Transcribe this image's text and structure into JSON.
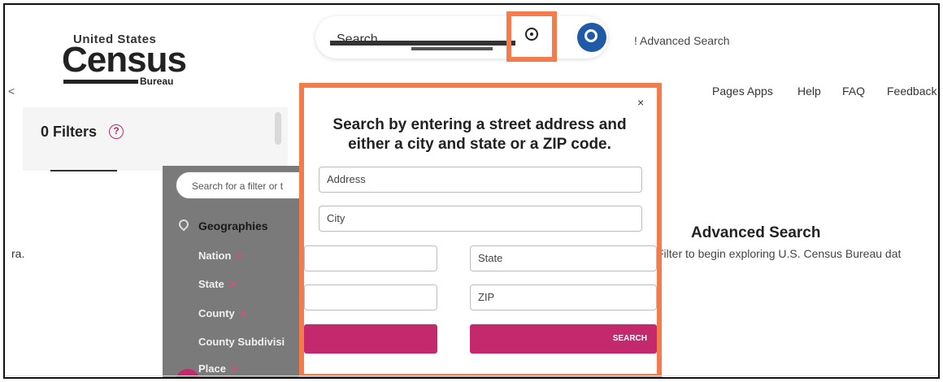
{
  "header": {
    "logo_line1": "United States",
    "logo_main": "Census",
    "logo_bureau": "Bureau",
    "search_placeholder": "Search",
    "advanced_link": "! Advanced Search",
    "back_glyph": "<",
    "location_icon": "location-pin-icon",
    "search_icon": "magnifier-icon"
  },
  "nav": {
    "items": [
      "Pages Apps",
      "Help",
      "FAQ",
      "Feedback"
    ]
  },
  "filters": {
    "title": "0 Filters",
    "help_glyph": "?",
    "search_placeholder": "Search for a filter or t",
    "geographies_label": "Geographies",
    "geo_items": [
      "Nation",
      "State",
      "County",
      "County Subdivisi",
      "Place"
    ],
    "chevron_glyph": ">"
  },
  "main": {
    "partial_left_text": "ra.",
    "advanced_title": "Advanced Search",
    "advanced_subtitle": "Filter to begin exploring U.S. Census Bureau dat"
  },
  "modal": {
    "close_glyph": "×",
    "title_line1": "Search by entering a street address and",
    "title_line2": "either a city and state or a ZIP code.",
    "address_placeholder": "Address",
    "city_placeholder": "City",
    "state_placeholder": "State",
    "zip_placeholder": "ZIP",
    "search_button": "SEARCH"
  },
  "colors": {
    "highlight": "#f47b4b",
    "accent": "#c4286d",
    "brand_blue": "#1f5aa6"
  }
}
